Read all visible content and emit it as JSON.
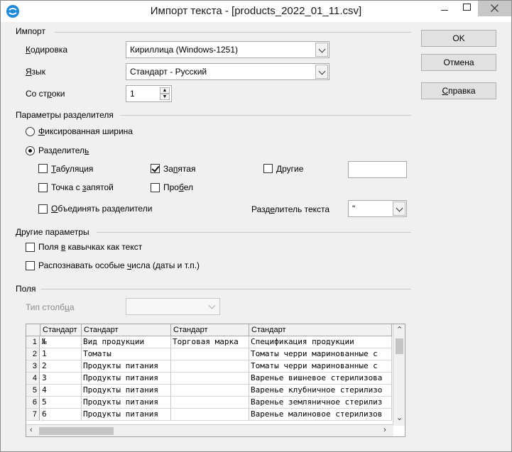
{
  "window": {
    "title": "Импорт текста - [products_2022_01_11.csv]"
  },
  "buttons": {
    "ok": "OK",
    "cancel": "Отмена",
    "help_prefix": "",
    "help_u": "С",
    "help_rest": "правка"
  },
  "import": {
    "section": "Импорт",
    "encoding_label_u": "К",
    "encoding_label_rest": "одировка",
    "encoding_value": "Кириллица (Windows-1251)",
    "language_label_u": "Я",
    "language_label_rest": "зык",
    "language_value": "Стандарт - Русский",
    "from_row_label_a": "Со ст",
    "from_row_label_u": "р",
    "from_row_label_b": "оки",
    "from_row_value": "1"
  },
  "separator": {
    "section": "Параметры разделителя",
    "fixed_width_u": "Ф",
    "fixed_width_rest": "иксированная ширина",
    "separated_a": "Разделител",
    "separated_u": "ь",
    "separated_checked": true,
    "fixed_checked": false,
    "tab_u": "Т",
    "tab_rest": "абуляция",
    "tab_checked": false,
    "comma_a": "За",
    "comma_u": "п",
    "comma_b": "ятая",
    "comma_checked": true,
    "other_u": "Д",
    "other_rest": "ругие",
    "other_checked": false,
    "other_value": "",
    "semicolon_a": "Точка с ",
    "semicolon_u": "з",
    "semicolon_b": "апятой",
    "semicolon_checked": false,
    "space_a": "Про",
    "space_u": "б",
    "space_b": "ел",
    "space_checked": false,
    "merge_u": "О",
    "merge_rest": "бъединять разделители",
    "merge_checked": false,
    "text_delim_a": "Разд",
    "text_delim_u": "е",
    "text_delim_b": "литель текста",
    "text_delim_value": "\""
  },
  "other_options": {
    "section": "Другие параметры",
    "quoted_a": "Поля ",
    "quoted_u": "в",
    "quoted_b": " кавычках как текст",
    "quoted_checked": false,
    "special_a": "Распознавать особые ",
    "special_u": "ч",
    "special_b": "исла (даты и т.п.)",
    "special_checked": false
  },
  "fields": {
    "section": "Поля",
    "column_type_a": "Тип столб",
    "column_type_u": "ц",
    "column_type_b": "а",
    "column_type_value": "",
    "headers": [
      "Стандарт",
      "Стандарт",
      "Стандарт",
      "Стандарт"
    ],
    "rows": [
      {
        "n": "1",
        "cells": [
          "№",
          "Вид продукции",
          "Торговая марка",
          "Спецификация продукции"
        ]
      },
      {
        "n": "2",
        "cells": [
          "1",
          "Томаты",
          "",
          "Томаты черри маринованные  с"
        ]
      },
      {
        "n": "3",
        "cells": [
          "2",
          "Продукты питания",
          "",
          "Томаты черри маринованные  с"
        ]
      },
      {
        "n": "4",
        "cells": [
          "3",
          "Продукты питания",
          "",
          "Варенье вишневое стерилизова"
        ]
      },
      {
        "n": "5",
        "cells": [
          "4",
          "Продукты питания",
          "",
          "Варенье клубничное стерилизо"
        ]
      },
      {
        "n": "6",
        "cells": [
          "5",
          "Продукты питания",
          "",
          "Варенье земляничное стерилиз"
        ]
      },
      {
        "n": "7",
        "cells": [
          "6",
          "Продукты питания",
          "",
          "Варенье малиновое стерилизов"
        ]
      }
    ]
  },
  "colors": {
    "title_bar": "#ffffff",
    "dialog_bg": "#f0f0f0",
    "close_hover": "#c7c7c7",
    "app_icon": "#1e8bd8"
  }
}
